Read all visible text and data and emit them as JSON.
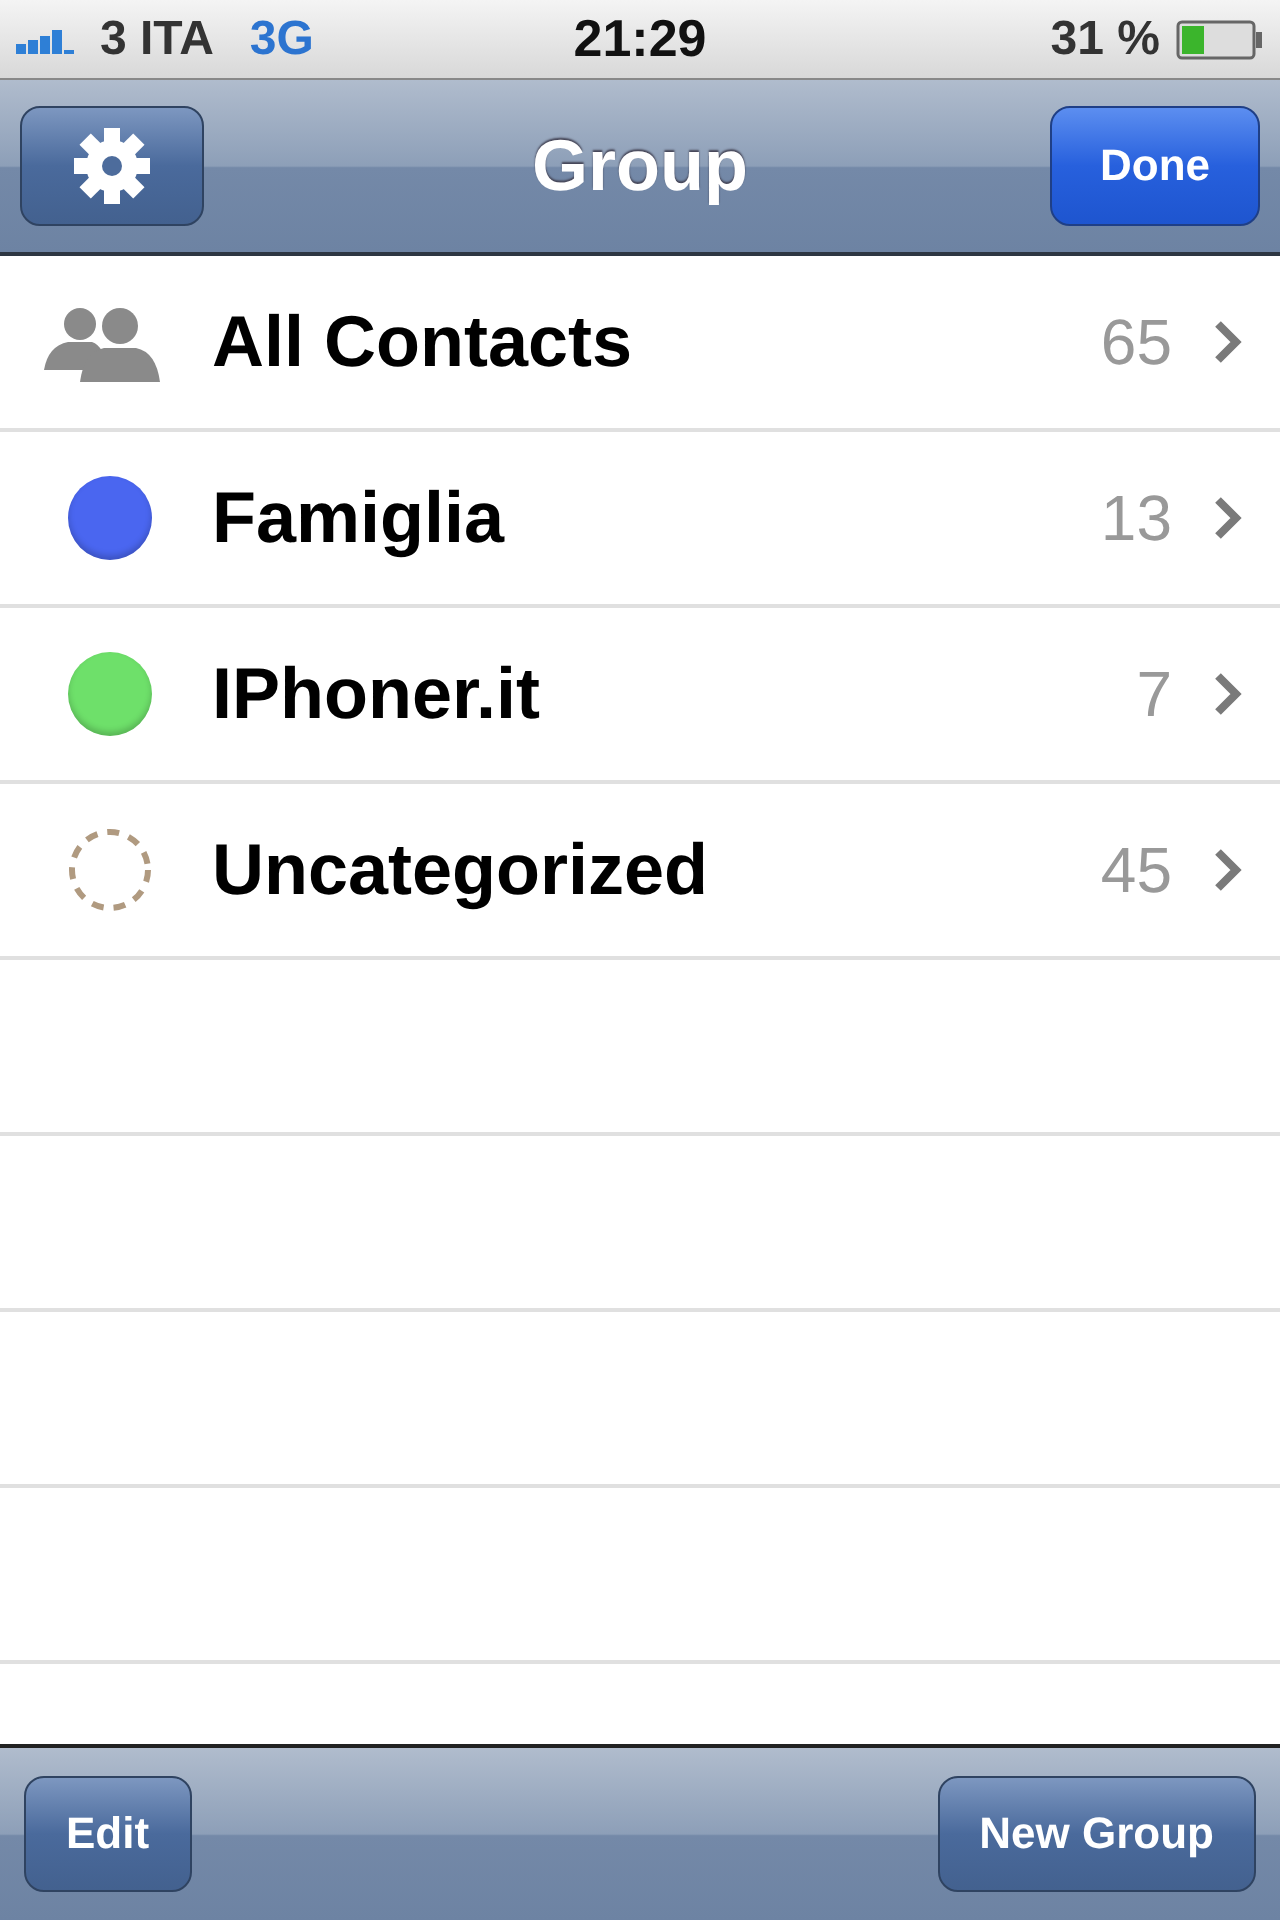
{
  "status_bar": {
    "carrier": "3 ITA",
    "network": "3G",
    "time": "21:29",
    "battery": "31 %"
  },
  "nav_bar": {
    "title": "Group",
    "right_button": "Done"
  },
  "groups": [
    {
      "kind": "all",
      "name": "All Contacts",
      "count": "65"
    },
    {
      "kind": "color",
      "name": "Famiglia",
      "count": "13",
      "color": "#4a66f0"
    },
    {
      "kind": "color",
      "name": "IPhoner.it",
      "count": "7",
      "color": "#6ee06a"
    },
    {
      "kind": "uncategorized",
      "name": "Uncategorized",
      "count": "45"
    }
  ],
  "toolbar": {
    "buttons": [
      "Edit",
      "New Group"
    ]
  }
}
